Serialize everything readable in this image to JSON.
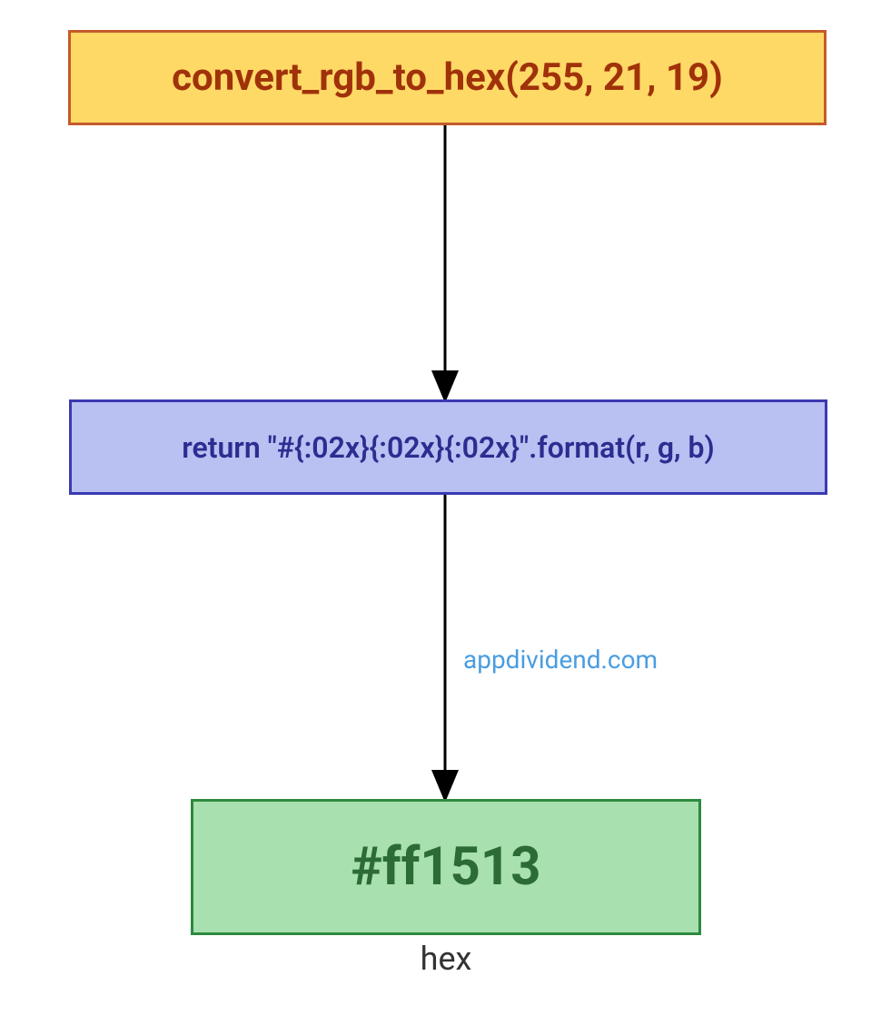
{
  "nodes": {
    "input": {
      "label": "convert_rgb_to_hex(255, 21, 19)"
    },
    "process": {
      "label": "return \"#{:02x}{:02x}{:02x}\".format(r, g, b)"
    },
    "output": {
      "label": "#ff1513",
      "caption": "hex"
    }
  },
  "watermark": "appdividend.com",
  "colors": {
    "input_bg": "#ffd966",
    "input_border": "#c55a2a",
    "input_text": "#a0320a",
    "process_bg": "#b9c0f2",
    "process_border": "#3a3ab0",
    "process_text": "#2b2d90",
    "output_bg": "#a9e0b0",
    "output_border": "#2d8a3e",
    "output_text": "#2c6b36",
    "watermark": "#4a9de0"
  }
}
